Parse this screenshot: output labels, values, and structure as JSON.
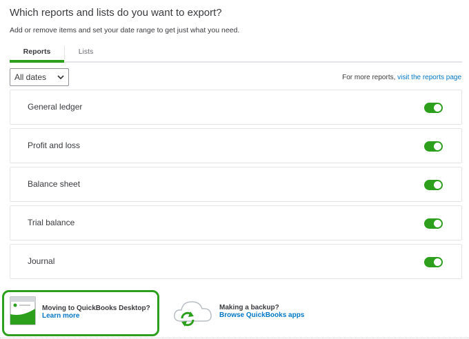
{
  "header": {
    "title": "Which reports and lists do you want to export?",
    "subtitle": "Add or remove items and set your date range to get just what you need."
  },
  "tabs": [
    {
      "label": "Reports",
      "active": true
    },
    {
      "label": "Lists",
      "active": false
    }
  ],
  "filters": {
    "date_range": "All dates",
    "more_reports_prefix": "For more reports, ",
    "more_reports_link": "visit the reports page"
  },
  "reports": [
    {
      "label": "General ledger",
      "enabled": true
    },
    {
      "label": "Profit and loss",
      "enabled": true
    },
    {
      "label": "Balance sheet",
      "enabled": true
    },
    {
      "label": "Trial balance",
      "enabled": true
    },
    {
      "label": "Journal",
      "enabled": true
    }
  ],
  "promos": {
    "desktop": {
      "title": "Moving to QuickBooks Desktop?",
      "link": "Learn more",
      "icon": "desktop-window-icon"
    },
    "backup": {
      "title": "Making a backup?",
      "link": "Browse QuickBooks apps",
      "icon": "cloud-sync-icon"
    }
  },
  "colors": {
    "accent": "#2ca01c",
    "link": "#0077c5",
    "text": "#393a3d",
    "highlight_border": "#2ca01c"
  }
}
